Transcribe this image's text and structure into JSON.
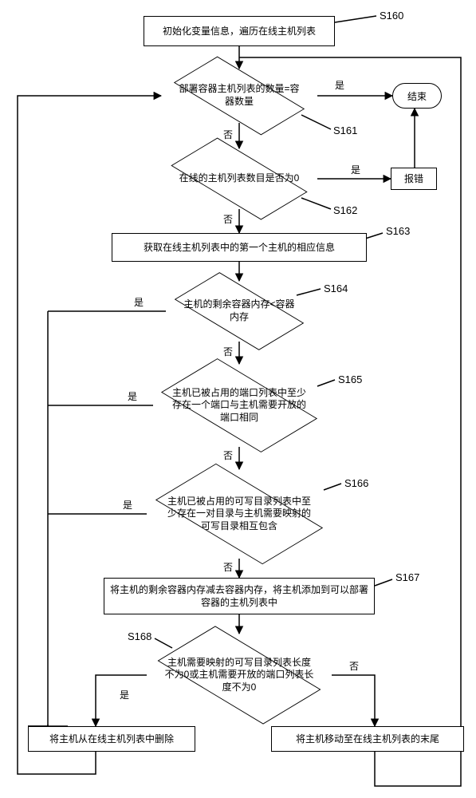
{
  "nodes": {
    "s160_box": "初始化变量信息，遍历在线主机列表",
    "s161_text": "部署容器主机列表的数量=容器数量",
    "s162_text": "在线的主机列表数目是否为0",
    "s163_box": "获取在线主机列表中的第一个主机的相应信息",
    "s164_text": "主机的剩余容器内存<容器内存",
    "s165_text": "主机已被占用的端口列表中至少存在一个端口与主机需要开放的端口相同",
    "s166_text": "主机已被占用的可写目录列表中至少存在一对目录与主机需要映射的可写目录相互包含",
    "s167_box": "将主机的剩余容器内存减去容器内存，将主机添加到可以部署容器的主机列表中",
    "s168_text": "主机需要映射的可写目录列表长度不为0或主机需要开放的端口列表长度不为0",
    "remove_box": "将主机从在线主机列表中删除",
    "move_box": "将主机移动至在线主机列表的末尾",
    "end_term": "结束",
    "error_box": "报错"
  },
  "steps": {
    "s160": "S160",
    "s161": "S161",
    "s162": "S162",
    "s163": "S163",
    "s164": "S164",
    "s165": "S165",
    "s166": "S166",
    "s167": "S167",
    "s168": "S168"
  },
  "edges": {
    "yes": "是",
    "no": "否"
  }
}
